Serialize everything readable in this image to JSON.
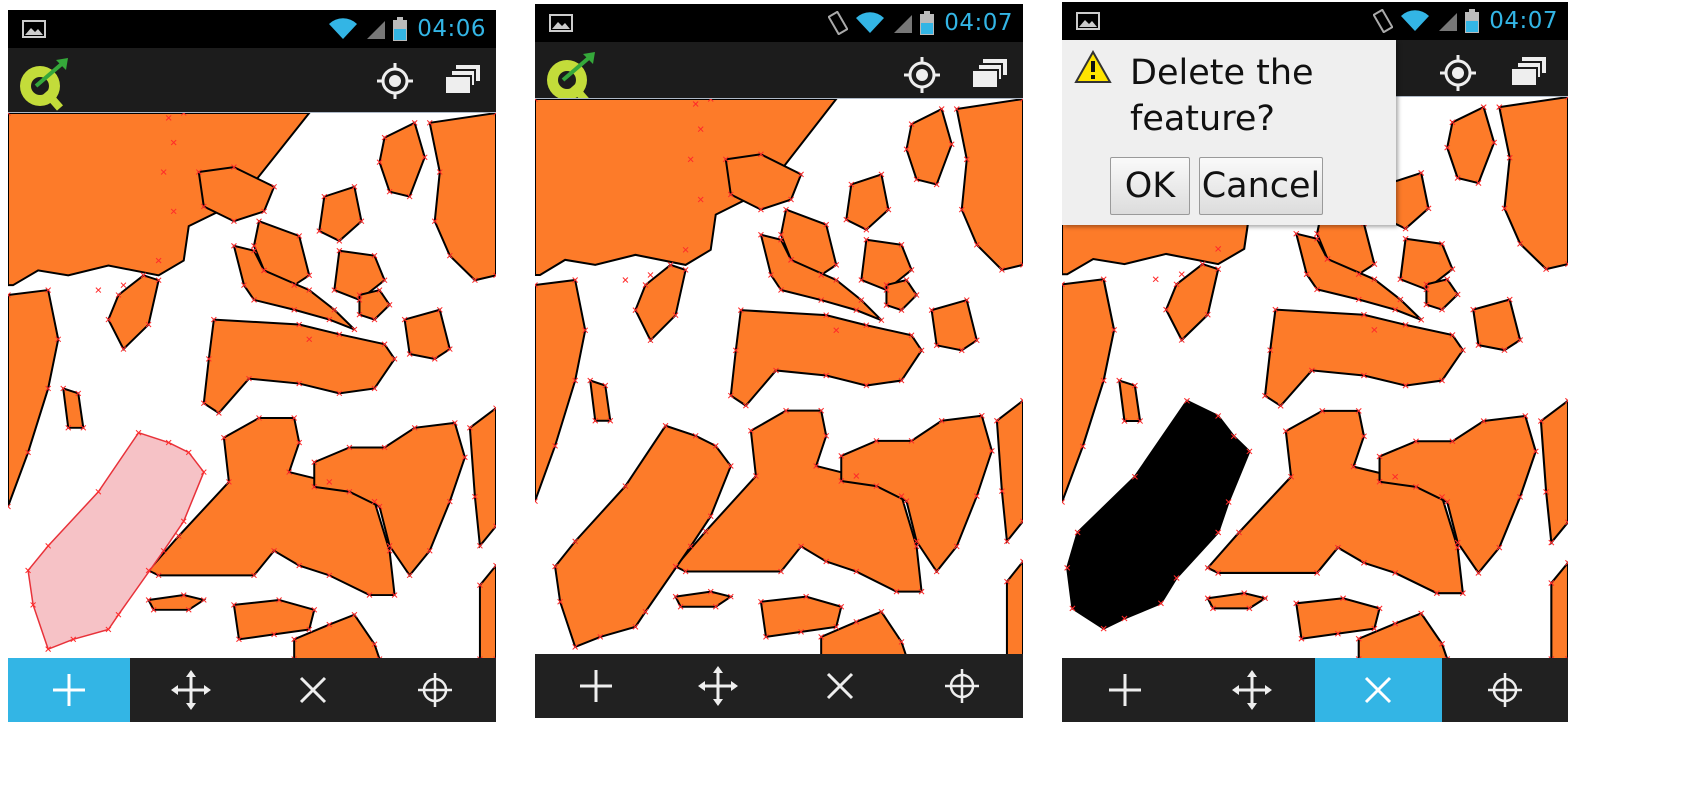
{
  "colors": {
    "feature_fill": "#fd7b29",
    "feature_outline": "#000000",
    "vertex_marker": "#ff2a2a",
    "accent": "#33b5e5",
    "new_feature_fill": "#f6c2c6",
    "selected_feature_fill": "#000000",
    "actionbar_bg": "#1c1c1c",
    "toolbar_bg": "#212121"
  },
  "screens": [
    {
      "status_time": "04:06",
      "actionbar": {
        "logo_icon": "qgis-logo",
        "locate_icon": "gps-target-icon",
        "layers_icon": "layers-icon"
      },
      "toolbar": {
        "active_tool": "add",
        "tools": [
          "add-feature-icon",
          "move-feature-icon",
          "delete-feature-icon",
          "add-vertex-icon"
        ]
      },
      "map_state": "digitizing new polygon"
    },
    {
      "status_time": "04:07",
      "actionbar": {
        "logo_icon": "qgis-logo",
        "locate_icon": "gps-target-icon",
        "layers_icon": "layers-icon"
      },
      "toolbar": {
        "active_tool": "none",
        "tools": [
          "add-feature-icon",
          "move-feature-icon",
          "delete-feature-icon",
          "add-vertex-icon"
        ]
      },
      "map_state": "polygon saved"
    },
    {
      "status_time": "04:07",
      "actionbar": {
        "logo_icon": "qgis-logo",
        "locate_icon": "gps-target-icon",
        "layers_icon": "layers-icon"
      },
      "toolbar": {
        "active_tool": "delete",
        "tools": [
          "add-feature-icon",
          "move-feature-icon",
          "delete-feature-icon",
          "add-vertex-icon"
        ]
      },
      "dialog": {
        "message": "Delete the feature?",
        "ok_label": "OK",
        "cancel_label": "Cancel",
        "icon": "warning-icon"
      }
    }
  ]
}
